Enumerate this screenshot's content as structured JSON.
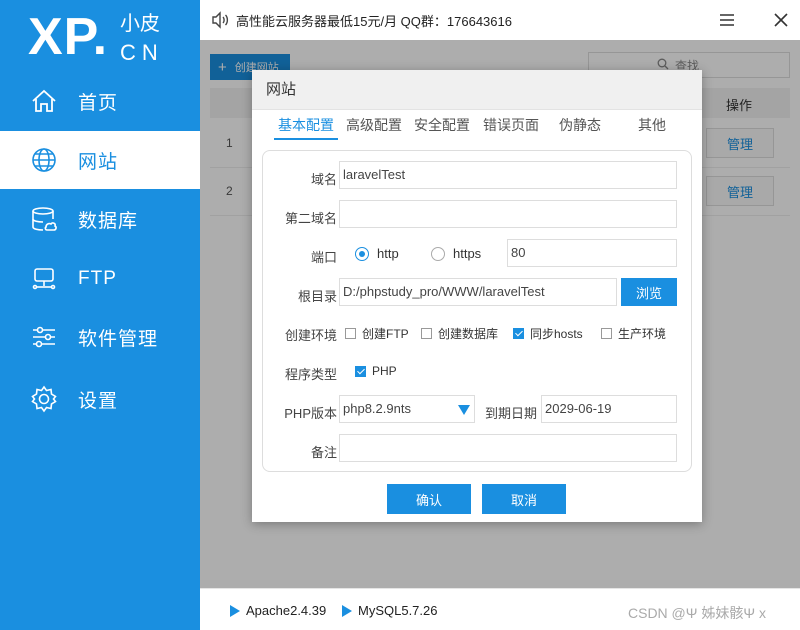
{
  "brand": {
    "logo_main": "XP.",
    "logo_sub_top": "小皮",
    "logo_sub_bottom": "CN"
  },
  "topbar": {
    "announcement": "高性能云服务器最低15元/月  QQ群：176643616"
  },
  "sidebar": {
    "items": [
      {
        "label": "首页",
        "icon": "home-icon",
        "active": false
      },
      {
        "label": "网站",
        "icon": "globe-icon",
        "active": true
      },
      {
        "label": "数据库",
        "icon": "database-icon",
        "active": false
      },
      {
        "label": "FTP",
        "icon": "ftp-icon",
        "active": false
      },
      {
        "label": "软件管理",
        "icon": "sliders-icon",
        "active": false
      },
      {
        "label": "设置",
        "icon": "gear-icon",
        "active": false
      }
    ]
  },
  "main": {
    "create_label": "创建网站",
    "search_placeholder": "查找",
    "op_header": "操作",
    "rows": [
      {
        "num": "1",
        "action": "管理"
      },
      {
        "num": "2",
        "action": "管理"
      }
    ]
  },
  "dialog": {
    "title": "网站",
    "tabs": [
      "基本配置",
      "高级配置",
      "安全配置",
      "错误页面",
      "伪静态",
      "其他"
    ],
    "active_tab": 0,
    "form": {
      "domain_label": "域名",
      "domain_value": "laravelTest",
      "second_domain_label": "第二域名",
      "second_domain_value": "",
      "port_label": "端口",
      "protocol_http": "http",
      "protocol_https": "https",
      "protocol_selected": "http",
      "port_value": "80",
      "root_label": "根目录",
      "root_value": "D:/phpstudy_pro/WWW/laravelTest",
      "browse_label": "浏览",
      "env_label": "创建环境",
      "env_options": [
        {
          "label": "创建FTP",
          "checked": false
        },
        {
          "label": "创建数据库",
          "checked": false
        },
        {
          "label": "同步hosts",
          "checked": true
        },
        {
          "label": "生产环境",
          "checked": false
        }
      ],
      "prog_type_label": "程序类型",
      "prog_type_option": {
        "label": "PHP",
        "checked": true
      },
      "php_version_label": "PHP版本",
      "php_version_value": "php8.2.9nts",
      "expire_label": "到期日期",
      "expire_value": "2029-06-19",
      "note_label": "备注",
      "note_value": ""
    },
    "confirm_label": "确认",
    "cancel_label": "取消"
  },
  "statusbar": {
    "services": [
      {
        "name": "Apache2.4.39"
      },
      {
        "name": "MySQL5.7.26"
      }
    ],
    "watermark": "CSDN @Ψ 姊妹骸Ψ x"
  },
  "colors": {
    "accent": "#1a8fe0",
    "sidebar_bg": "#1a8fe0"
  }
}
